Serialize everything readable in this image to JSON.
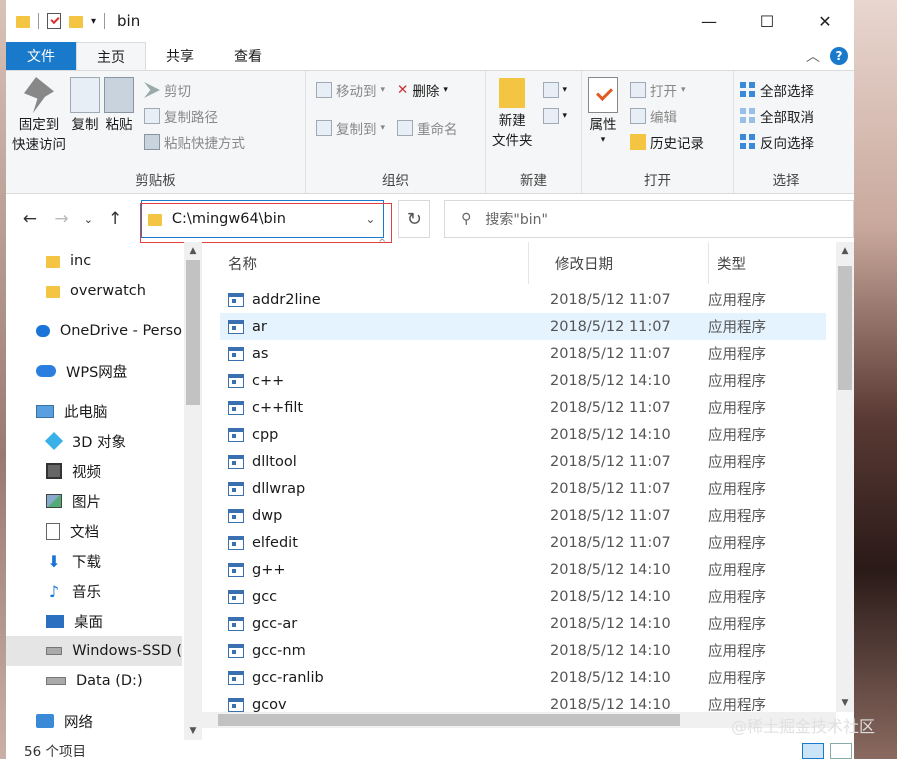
{
  "window": {
    "title": "bin",
    "controls": {
      "minimize": "—",
      "maximize": "☐",
      "close": "✕"
    }
  },
  "tabs": [
    "文件",
    "主页",
    "共享",
    "查看"
  ],
  "ribbon": {
    "clipboard": {
      "label": "剪贴板",
      "pin": "固定到\n快速访问",
      "pin_l1": "固定到",
      "pin_l2": "快速访问",
      "copy": "复制",
      "paste": "粘贴",
      "cut": "剪切",
      "copy_path": "复制路径",
      "paste_shortcut": "粘贴快捷方式"
    },
    "organize": {
      "label": "组织",
      "move_to": "移动到",
      "copy_to": "复制到",
      "delete": "删除",
      "rename": "重命名"
    },
    "new": {
      "label": "新建",
      "new_folder_l1": "新建",
      "new_folder_l2": "文件夹"
    },
    "open": {
      "label": "打开",
      "properties": "属性",
      "open": "打开",
      "edit": "编辑",
      "history": "历史记录"
    },
    "select": {
      "label": "选择",
      "select_all": "全部选择",
      "select_none": "全部取消",
      "invert": "反向选择"
    }
  },
  "address": {
    "path": "C:\\mingw64\\bin",
    "search_placeholder": "搜索\"bin\""
  },
  "nav": [
    {
      "label": "inc",
      "icon": "folder-icon",
      "sub": true
    },
    {
      "label": "overwatch",
      "icon": "folder-icon",
      "sub": true
    },
    {
      "label": "OneDrive - Perso",
      "icon": "onedrive-icon",
      "sub": false
    },
    {
      "label": "WPS网盘",
      "icon": "wps-cloud-icon",
      "sub": false
    },
    {
      "label": "此电脑",
      "icon": "pc-icon",
      "sub": false
    },
    {
      "label": "3D 对象",
      "icon": "cube-icon",
      "sub": true
    },
    {
      "label": "视频",
      "icon": "video-icon",
      "sub": true
    },
    {
      "label": "图片",
      "icon": "picture-icon",
      "sub": true
    },
    {
      "label": "文档",
      "icon": "document-icon",
      "sub": true
    },
    {
      "label": "下载",
      "icon": "download-icon",
      "sub": true
    },
    {
      "label": "音乐",
      "icon": "music-icon",
      "sub": true
    },
    {
      "label": "桌面",
      "icon": "desktop-icon",
      "sub": true
    },
    {
      "label": "Windows-SSD (",
      "icon": "drive-icon",
      "sub": true
    },
    {
      "label": "Data (D:)",
      "icon": "drive-icon",
      "sub": true
    },
    {
      "label": "网络",
      "icon": "network-icon",
      "sub": false
    }
  ],
  "columns": {
    "name": "名称",
    "date": "修改日期",
    "type": "类型"
  },
  "files": [
    {
      "name": "addr2line",
      "date": "2018/5/12 11:07",
      "type": "应用程序"
    },
    {
      "name": "ar",
      "date": "2018/5/12 11:07",
      "type": "应用程序"
    },
    {
      "name": "as",
      "date": "2018/5/12 11:07",
      "type": "应用程序"
    },
    {
      "name": "c++",
      "date": "2018/5/12 14:10",
      "type": "应用程序"
    },
    {
      "name": "c++filt",
      "date": "2018/5/12 11:07",
      "type": "应用程序"
    },
    {
      "name": "cpp",
      "date": "2018/5/12 14:10",
      "type": "应用程序"
    },
    {
      "name": "dlltool",
      "date": "2018/5/12 11:07",
      "type": "应用程序"
    },
    {
      "name": "dllwrap",
      "date": "2018/5/12 11:07",
      "type": "应用程序"
    },
    {
      "name": "dwp",
      "date": "2018/5/12 11:07",
      "type": "应用程序"
    },
    {
      "name": "elfedit",
      "date": "2018/5/12 11:07",
      "type": "应用程序"
    },
    {
      "name": "g++",
      "date": "2018/5/12 14:10",
      "type": "应用程序"
    },
    {
      "name": "gcc",
      "date": "2018/5/12 14:10",
      "type": "应用程序"
    },
    {
      "name": "gcc-ar",
      "date": "2018/5/12 14:10",
      "type": "应用程序"
    },
    {
      "name": "gcc-nm",
      "date": "2018/5/12 14:10",
      "type": "应用程序"
    },
    {
      "name": "gcc-ranlib",
      "date": "2018/5/12 14:10",
      "type": "应用程序"
    },
    {
      "name": "gcov",
      "date": "2018/5/12 14:10",
      "type": "应用程序"
    }
  ],
  "status": {
    "count": "56 个项目"
  },
  "watermark": "@稀土掘金技术社区"
}
